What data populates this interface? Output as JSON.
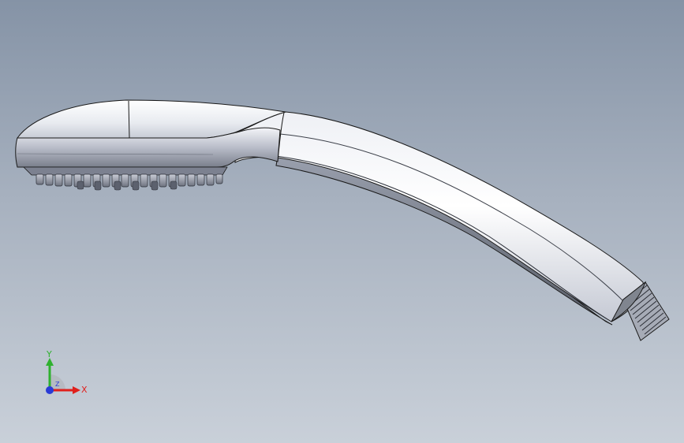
{
  "viewport": {
    "background_top": "#8593a6",
    "background_bottom": "#c9d0d9"
  },
  "model": {
    "part": "hand shower",
    "body_color": "#d9dde6",
    "edge_color": "#1a1a1a",
    "thread_color": "#9aa0aa"
  },
  "triad": {
    "x_label": "X",
    "y_label": "Y",
    "z_label": "Z",
    "x_color": "#e0201c",
    "y_color": "#2fb12f",
    "z_color": "#2a3bd6"
  }
}
